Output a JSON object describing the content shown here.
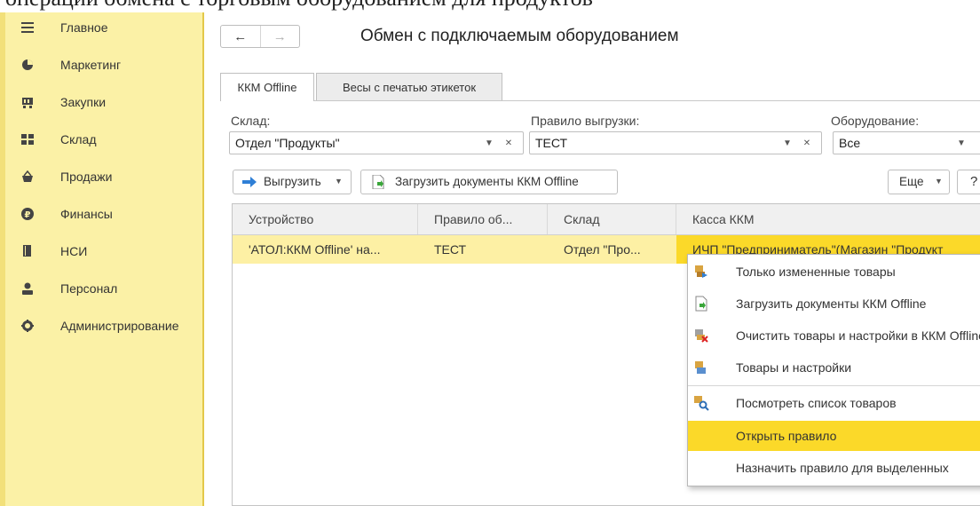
{
  "top_caption": "операций обмена с торговым оборудованием для продуктов",
  "sidebar": {
    "items": [
      {
        "label": "Главное",
        "icon": "menu-icon"
      },
      {
        "label": "Маркетинг",
        "icon": "pie-chart-icon"
      },
      {
        "label": "Закупки",
        "icon": "cart-icon"
      },
      {
        "label": "Склад",
        "icon": "warehouse-icon"
      },
      {
        "label": "Продажи",
        "icon": "basket-icon"
      },
      {
        "label": "Финансы",
        "icon": "ruble-icon"
      },
      {
        "label": "НСИ",
        "icon": "book-icon"
      },
      {
        "label": "Персонал",
        "icon": "person-icon"
      },
      {
        "label": "Администрирование",
        "icon": "gear-icon"
      }
    ]
  },
  "header": {
    "back": "←",
    "forward": "→",
    "title": "Обмен с подключаемым оборудованием"
  },
  "tabs": [
    {
      "label": "ККМ Offline"
    },
    {
      "label": "Весы с печатью этикеток"
    }
  ],
  "filters": {
    "warehouse": {
      "label": "Склад:",
      "value": "Отдел \"Продукты\""
    },
    "rule": {
      "label": "Правило выгрузки:",
      "value": "ТЕСТ"
    },
    "equipment": {
      "label": "Оборудование:",
      "value": "Все"
    }
  },
  "toolbar": {
    "export": "Выгрузить",
    "import": "Загрузить документы ККМ Offline",
    "more": "Еще",
    "help": "?"
  },
  "table": {
    "columns": [
      "Устройство",
      "Правило об...",
      "Склад",
      "Касса ККМ"
    ],
    "rows": [
      [
        "'АТОЛ:ККМ Offline' на...",
        "ТЕСТ",
        "Отдел \"Про...",
        "ИЧП \"Предприниматель\"(Магазин \"Продукт"
      ]
    ]
  },
  "context_menu": {
    "items": [
      {
        "label": "Только измененные товары",
        "icon": "changed-goods-icon"
      },
      {
        "label": "Загрузить документы ККМ Offline",
        "icon": "load-docs-icon"
      },
      {
        "label": "Очистить товары и настройки в ККМ Offline",
        "icon": "clear-goods-icon"
      },
      {
        "label": "Товары и настройки",
        "icon": "goods-settings-icon"
      },
      {
        "label": "Посмотреть список товаров",
        "icon": "view-list-icon"
      },
      {
        "label": "Открыть правило",
        "icon": ""
      },
      {
        "label": "Назначить правило для выделенных",
        "icon": ""
      }
    ],
    "highlight_index": 5
  },
  "colors": {
    "sidebar_bg": "#fbf1a6",
    "selected_row": "#fdf0a4",
    "menu_highlight": "#fbd929",
    "accent_blue": "#2f7fd6"
  }
}
